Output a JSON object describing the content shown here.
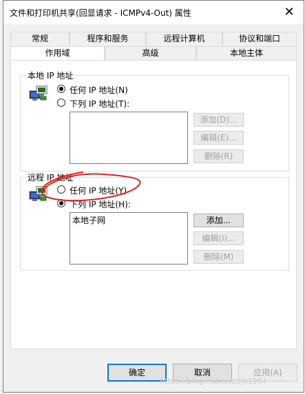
{
  "window": {
    "title": "文件和打印机共享(回显请求 - ICMPv4-Out) 属性",
    "close_glyph": "✕"
  },
  "tabs": {
    "row1": [
      {
        "label": "常规"
      },
      {
        "label": "程序和服务"
      },
      {
        "label": "远程计算机"
      },
      {
        "label": "协议和端口"
      }
    ],
    "row2": [
      {
        "label": "作用域",
        "active": true
      },
      {
        "label": "高级"
      },
      {
        "label": "本地主体"
      }
    ]
  },
  "local_ip": {
    "label": "本地 IP 地址",
    "any_label": "任何 IP 地址(N)",
    "list_label": "下列 IP 地址(T):",
    "selected": "any",
    "items": [],
    "add_label": "添加(D)...",
    "edit_label": "编辑(E)...",
    "remove_label": "删除(R)"
  },
  "remote_ip": {
    "label": "远程 IP 地址",
    "any_label": "任何 IP 地址(Y)",
    "list_label": "下列 IP 地址(H):",
    "selected": "list",
    "items": [
      "本地子网"
    ],
    "add_label": "添加...",
    "edit_label": "编辑(I)...",
    "remove_label": "删除(M)"
  },
  "footer": {
    "ok_label": "确定",
    "cancel_label": "取消",
    "apply_label": "应用(A)"
  },
  "watermark": "https://blog.csdn.net/jh1997",
  "colors": {
    "accent": "#0078d7",
    "annotation": "#e0201b"
  },
  "icons": {
    "local": "network-computers-icon",
    "remote": "network-computers-icon"
  }
}
